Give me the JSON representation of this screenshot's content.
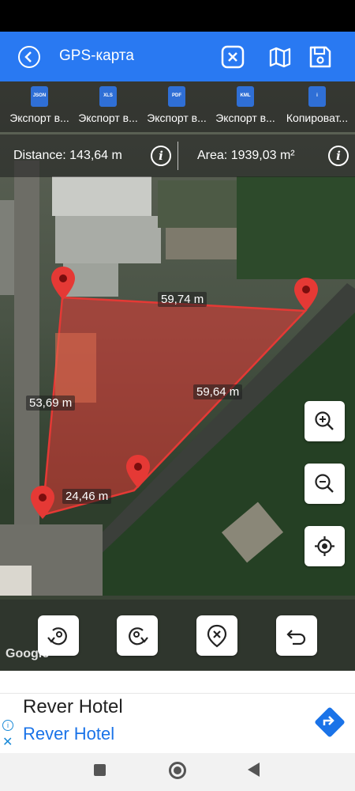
{
  "app": {
    "title": "GPS-карта"
  },
  "export_items": [
    {
      "badge": "JSON",
      "label": "Экспорт в..."
    },
    {
      "badge": "XLS",
      "label": "Экспорт в..."
    },
    {
      "badge": "PDF",
      "label": "Экспорт в..."
    },
    {
      "badge": "KML",
      "label": "Экспорт в..."
    },
    {
      "badge": "i",
      "label": "Копироват..."
    }
  ],
  "measure": {
    "distance": "Distance: 143,64 m",
    "area": "Area: 1939,03 m²",
    "info_glyph": "i"
  },
  "segments": {
    "top": "59,74 m",
    "right": "59,64 m",
    "left": "53,69 m",
    "bottom": "24,46 m"
  },
  "watermark": "Google",
  "ad": {
    "line1": "Rever Hotel",
    "line2": "Rever Hotel",
    "close_glyph": "✕",
    "info_glyph": "i"
  },
  "icons": {
    "back": "arrow-left-icon",
    "clear": "close-icon",
    "map": "map-icon",
    "save": "save-icon",
    "zoom_in": "zoom-in-icon",
    "zoom_out": "zoom-out-icon",
    "locate": "locate-icon",
    "undo_rotate": "rotate-left-icon",
    "redo_rotate": "rotate-right-icon",
    "delete_point": "delete-point-icon",
    "undo": "undo-icon",
    "directions": "directions-icon"
  },
  "colors": {
    "app_bar": "#2979f2",
    "polygon": "#e53935",
    "pin": "#e53935",
    "ad_link": "#1a73e8"
  }
}
